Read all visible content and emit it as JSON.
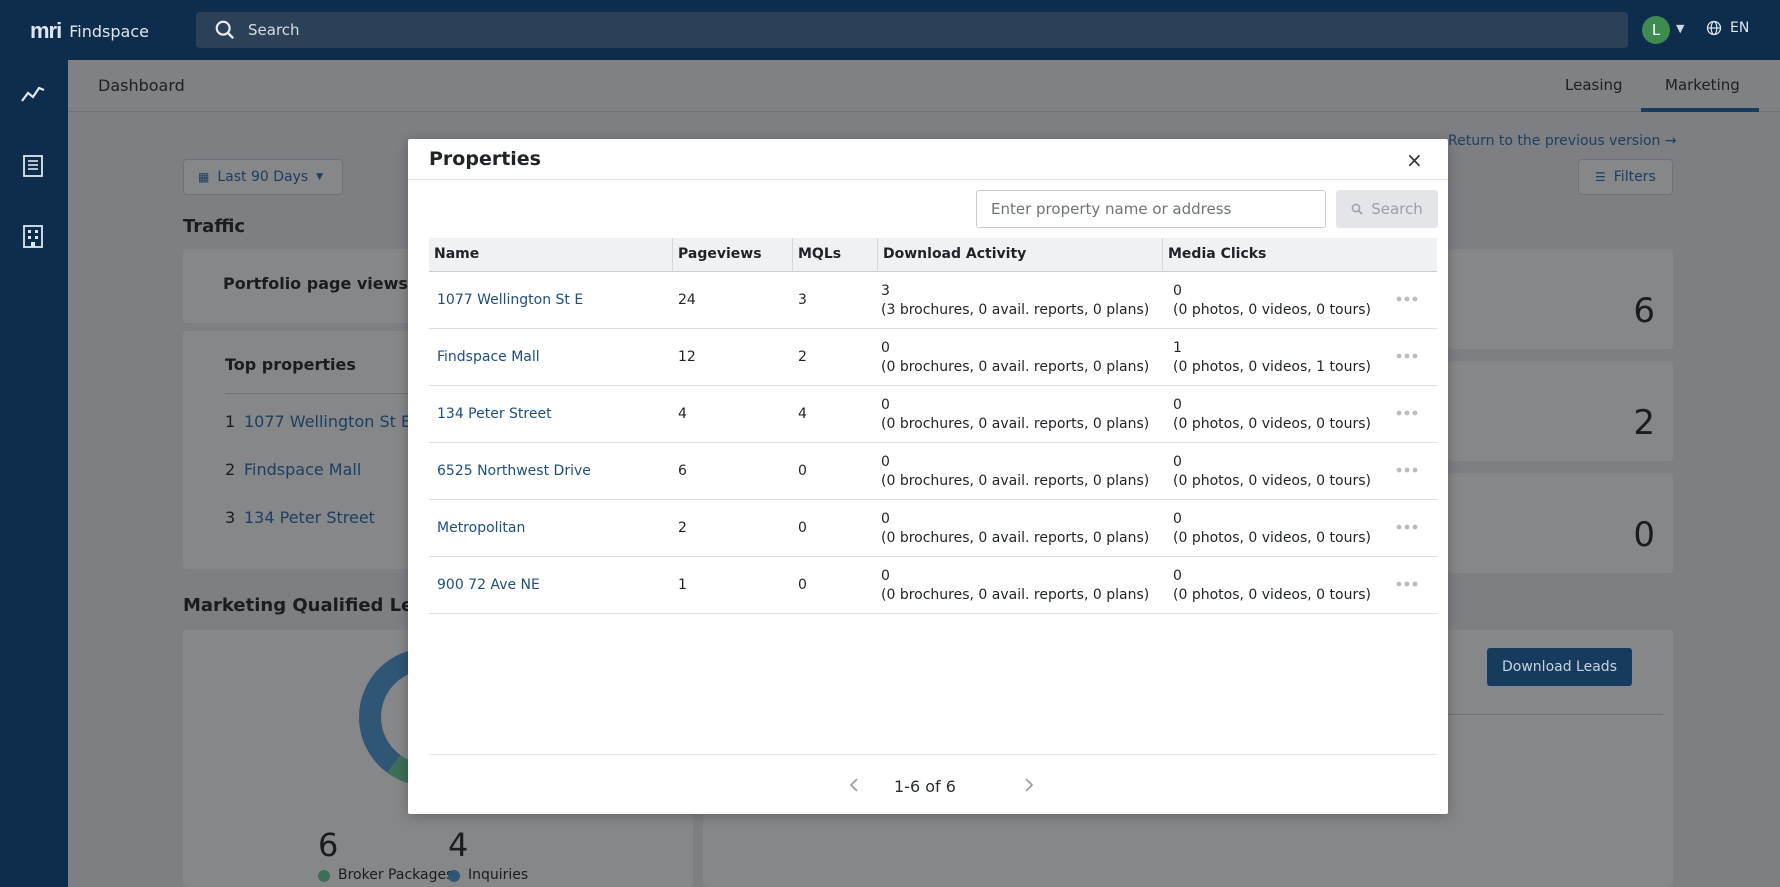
{
  "app": {
    "logo_mark": "mri",
    "name": "Findspace",
    "search_placeholder": "Search",
    "avatar_initial": "L",
    "language": "EN"
  },
  "page": {
    "title": "Dashboard",
    "tabs": [
      "Leasing",
      "Marketing"
    ],
    "active_tab": "Marketing",
    "return_link": "Return to the previous version →",
    "date_range": "Last 90 Days",
    "filters_label": "Filters",
    "traffic_heading": "Traffic",
    "portfolio_views_label": "Portfolio page views",
    "top_properties_label": "Top properties",
    "top_properties": [
      {
        "rank": "1",
        "name": "1077 Wellington St E"
      },
      {
        "rank": "2",
        "name": "Findspace Mall"
      },
      {
        "rank": "3",
        "name": "134 Peter Street"
      }
    ],
    "side_values": [
      "6",
      "2",
      "0"
    ],
    "mql_heading": "Marketing Qualified Leads",
    "download_leads": "Download Leads",
    "donut_values": [
      {
        "value": "6",
        "label": "Broker Packages",
        "color": "#2f7a4f"
      },
      {
        "value": "4",
        "label": "Inquiries",
        "color": "#27609a"
      }
    ]
  },
  "modal": {
    "title": "Properties",
    "close": "×",
    "search_placeholder": "Enter property name or address",
    "search_button": "Search",
    "columns": [
      "Name",
      "Pageviews",
      "MQLs",
      "Download Activity",
      "Media Clicks"
    ],
    "rows": [
      {
        "name": "1077 Wellington St E",
        "pageviews": "24",
        "mqls": "3",
        "download_total": "3",
        "download_detail": "(3 brochures, 0 avail. reports, 0 plans)",
        "media_total": "0",
        "media_detail": "(0 photos, 0 videos, 0 tours)"
      },
      {
        "name": "Findspace Mall",
        "pageviews": "12",
        "mqls": "2",
        "download_total": "0",
        "download_detail": "(0 brochures, 0 avail. reports, 0 plans)",
        "media_total": "1",
        "media_detail": "(0 photos, 0 videos, 1 tours)"
      },
      {
        "name": "134 Peter Street",
        "pageviews": "4",
        "mqls": "4",
        "download_total": "0",
        "download_detail": "(0 brochures, 0 avail. reports, 0 plans)",
        "media_total": "0",
        "media_detail": "(0 photos, 0 videos, 0 tours)"
      },
      {
        "name": "6525 Northwest Drive",
        "pageviews": "6",
        "mqls": "0",
        "download_total": "0",
        "download_detail": "(0 brochures, 0 avail. reports, 0 plans)",
        "media_total": "0",
        "media_detail": "(0 photos, 0 videos, 0 tours)"
      },
      {
        "name": "Metropolitan",
        "pageviews": "2",
        "mqls": "0",
        "download_total": "0",
        "download_detail": "(0 brochures, 0 avail. reports, 0 plans)",
        "media_total": "0",
        "media_detail": "(0 photos, 0 videos, 0 tours)"
      },
      {
        "name": "900 72 Ave NE",
        "pageviews": "1",
        "mqls": "0",
        "download_total": "0",
        "download_detail": "(0 brochures, 0 avail. reports, 0 plans)",
        "media_total": "0",
        "media_detail": "(0 photos, 0 videos, 0 tours)"
      }
    ],
    "pagination": "1-6 of 6"
  }
}
